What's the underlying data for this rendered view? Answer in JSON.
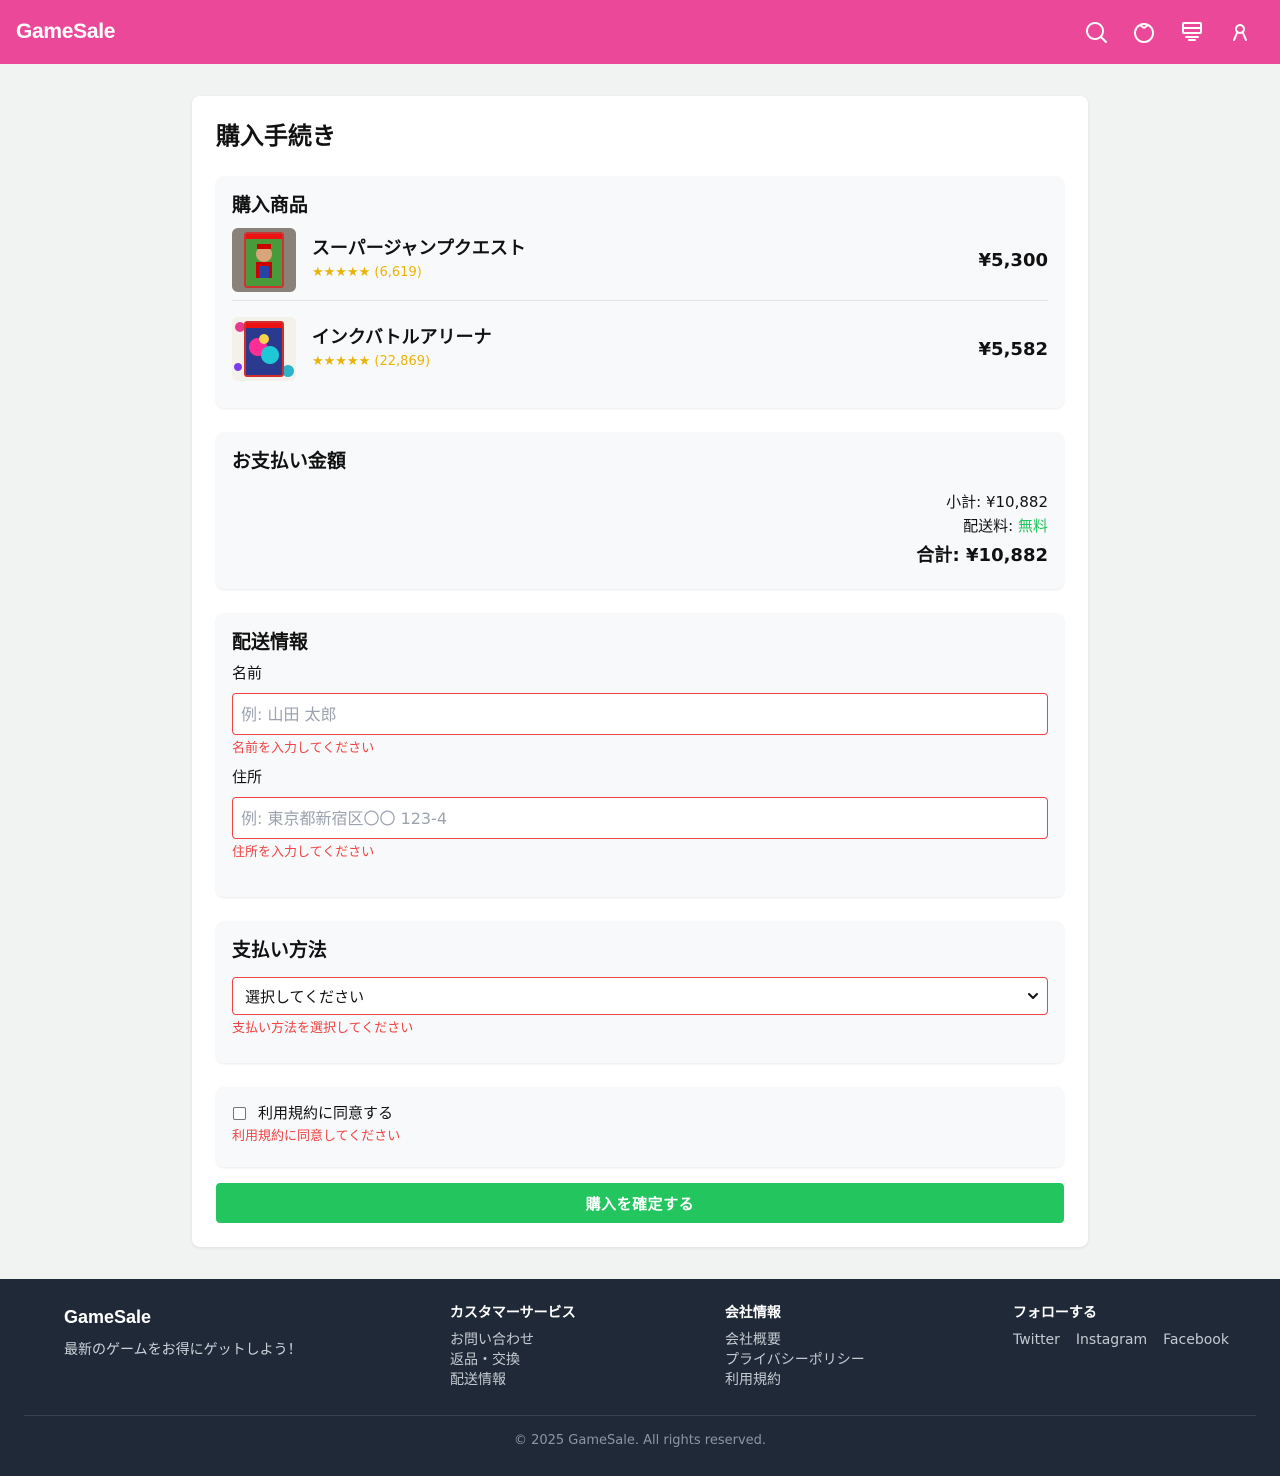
{
  "header": {
    "logo": "GameSale",
    "icons": [
      "search-icon",
      "globe-icon",
      "cart-icon",
      "user-icon"
    ]
  },
  "checkout": {
    "title": "購入手続き",
    "products": {
      "title": "購入商品",
      "items": [
        {
          "name": "スーパージャンプクエスト",
          "stars": "★★★★★",
          "reviews": "(6,619)",
          "price": "¥5,300"
        },
        {
          "name": "インクバトルアリーナ",
          "stars": "★★★★★",
          "reviews": "(22,869)",
          "price": "¥5,582"
        }
      ]
    },
    "payment_summary": {
      "title": "お支払い金額",
      "subtotal_label": "小計: ",
      "subtotal": "¥10,882",
      "shipping_label": "配送料: ",
      "shipping": "無料",
      "total_label": "合計: ",
      "total": "¥10,882"
    },
    "shipping_info": {
      "title": "配送情報",
      "name_label": "名前",
      "name_placeholder": "例: 山田 太郎",
      "name_value": "",
      "name_error": "名前を入力してください",
      "address_label": "住所",
      "address_placeholder": "例: 東京都新宿区〇〇 123-4",
      "address_value": "",
      "address_error": "住所を入力してください"
    },
    "payment_method": {
      "title": "支払い方法",
      "selected": "選択してください",
      "error": "支払い方法を選択してください"
    },
    "terms": {
      "label": "利用規約に同意する",
      "checked": false,
      "error": "利用規約に同意してください"
    },
    "confirm_button": "購入を確定する"
  },
  "footer": {
    "brand": "GameSale",
    "tagline": "最新のゲームをお得にゲットしよう！",
    "customer_service": {
      "title": "カスタマーサービス",
      "links": [
        "お問い合わせ",
        "返品・交換",
        "配送情報"
      ]
    },
    "company": {
      "title": "会社情報",
      "links": [
        "会社概要",
        "プライバシーポリシー",
        "利用規約"
      ]
    },
    "follow": {
      "title": "フォローする",
      "links": [
        "Twitter",
        "Instagram",
        "Facebook"
      ]
    },
    "copyright": "© 2025 GameSale. All rights reserved."
  },
  "colors": {
    "header": "#ec4899",
    "confirm": "#22c55e",
    "error": "#ef4444",
    "star": "#eab308",
    "footer": "#1f2937"
  }
}
